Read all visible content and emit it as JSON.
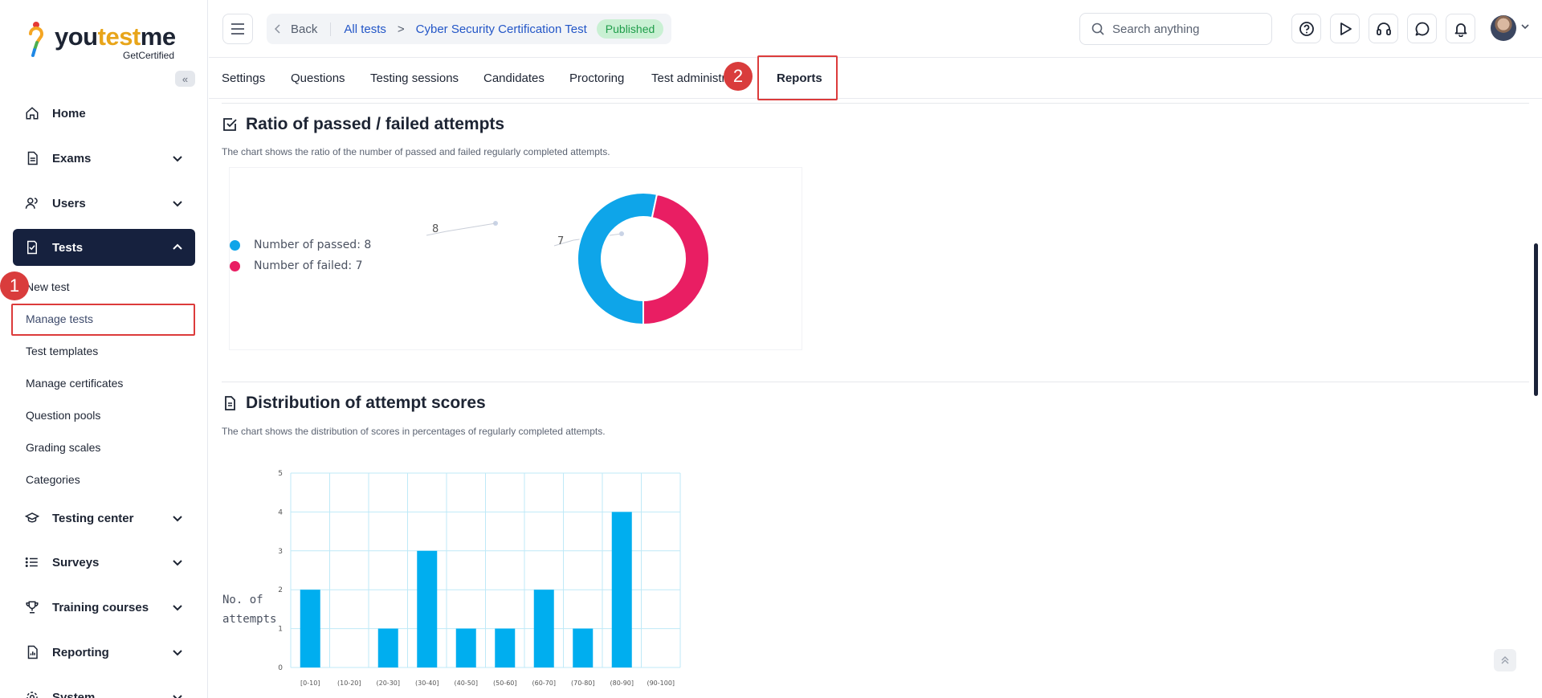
{
  "brand": {
    "logo_main": "you",
    "logo_accent": "test",
    "logo_tail": "me",
    "logo_sub": "GetCertified"
  },
  "sidebar": {
    "collapse_label": "«",
    "items": [
      {
        "label": "Home",
        "icon": "home-icon"
      },
      {
        "label": "Exams",
        "icon": "document-icon"
      },
      {
        "label": "Users",
        "icon": "users-icon"
      },
      {
        "label": "Tests",
        "icon": "test-icon"
      },
      {
        "label": "Testing center",
        "icon": "graduation-icon"
      },
      {
        "label": "Surveys",
        "icon": "list-icon"
      },
      {
        "label": "Training courses",
        "icon": "trophy-icon"
      },
      {
        "label": "Reporting",
        "icon": "report-icon"
      },
      {
        "label": "System",
        "icon": "gear-icon"
      }
    ],
    "tests_subitems": [
      "New test",
      "Manage tests",
      "Test templates",
      "Manage certificates",
      "Question pools",
      "Grading scales",
      "Categories"
    ]
  },
  "annotations": {
    "step1": "1",
    "step2": "2"
  },
  "header": {
    "back_label": "Back",
    "crumb_all_tests": "All tests",
    "crumb_sep": ">",
    "crumb_test_name": "Cyber Security Certification Test",
    "status_badge": "Published",
    "search_placeholder": "Search anything"
  },
  "tabs": [
    "Settings",
    "Questions",
    "Testing sessions",
    "Candidates",
    "Proctoring",
    "Test administration",
    "Reports"
  ],
  "active_tab": "Reports",
  "section1": {
    "title": "Ratio of passed / failed attempts",
    "description": "The chart shows the ratio of the number of passed and failed regularly completed attempts.",
    "legend": [
      "Number of passed: 8",
      "Number of failed: 7"
    ],
    "label_passed": "8",
    "label_failed": "7"
  },
  "section2": {
    "title": "Distribution of attempt scores",
    "description": "The chart shows the distribution of scores in percentages of regularly completed attempts.",
    "ylabel_line1": "No. of",
    "ylabel_line2": "attempts"
  },
  "colors": {
    "passed": "#0ea5e9",
    "failed": "#e91e63",
    "bar": "#00aeef",
    "sidebar_active": "#16213e",
    "highlight": "#dc3b3b"
  },
  "chart_data": [
    {
      "type": "pie",
      "title": "Ratio of passed / failed attempts",
      "labels": [
        "Number of passed",
        "Number of failed"
      ],
      "values": [
        8,
        7
      ],
      "colors": [
        "#0ea5e9",
        "#e91e63"
      ]
    },
    {
      "type": "bar",
      "title": "Distribution of attempt scores",
      "categories": [
        "[0-10]",
        "(10-20]",
        "(20-30]",
        "(30-40]",
        "(40-50]",
        "(50-60]",
        "(60-70]",
        "(70-80]",
        "(80-90]",
        "(90-100]"
      ],
      "values": [
        2,
        0,
        1,
        3,
        1,
        1,
        2,
        1,
        4,
        0
      ],
      "ylabel": "No. of attempts",
      "ylim": [
        0,
        5
      ],
      "yticks": [
        0,
        1,
        2,
        3,
        4,
        5
      ],
      "grid": true
    }
  ]
}
